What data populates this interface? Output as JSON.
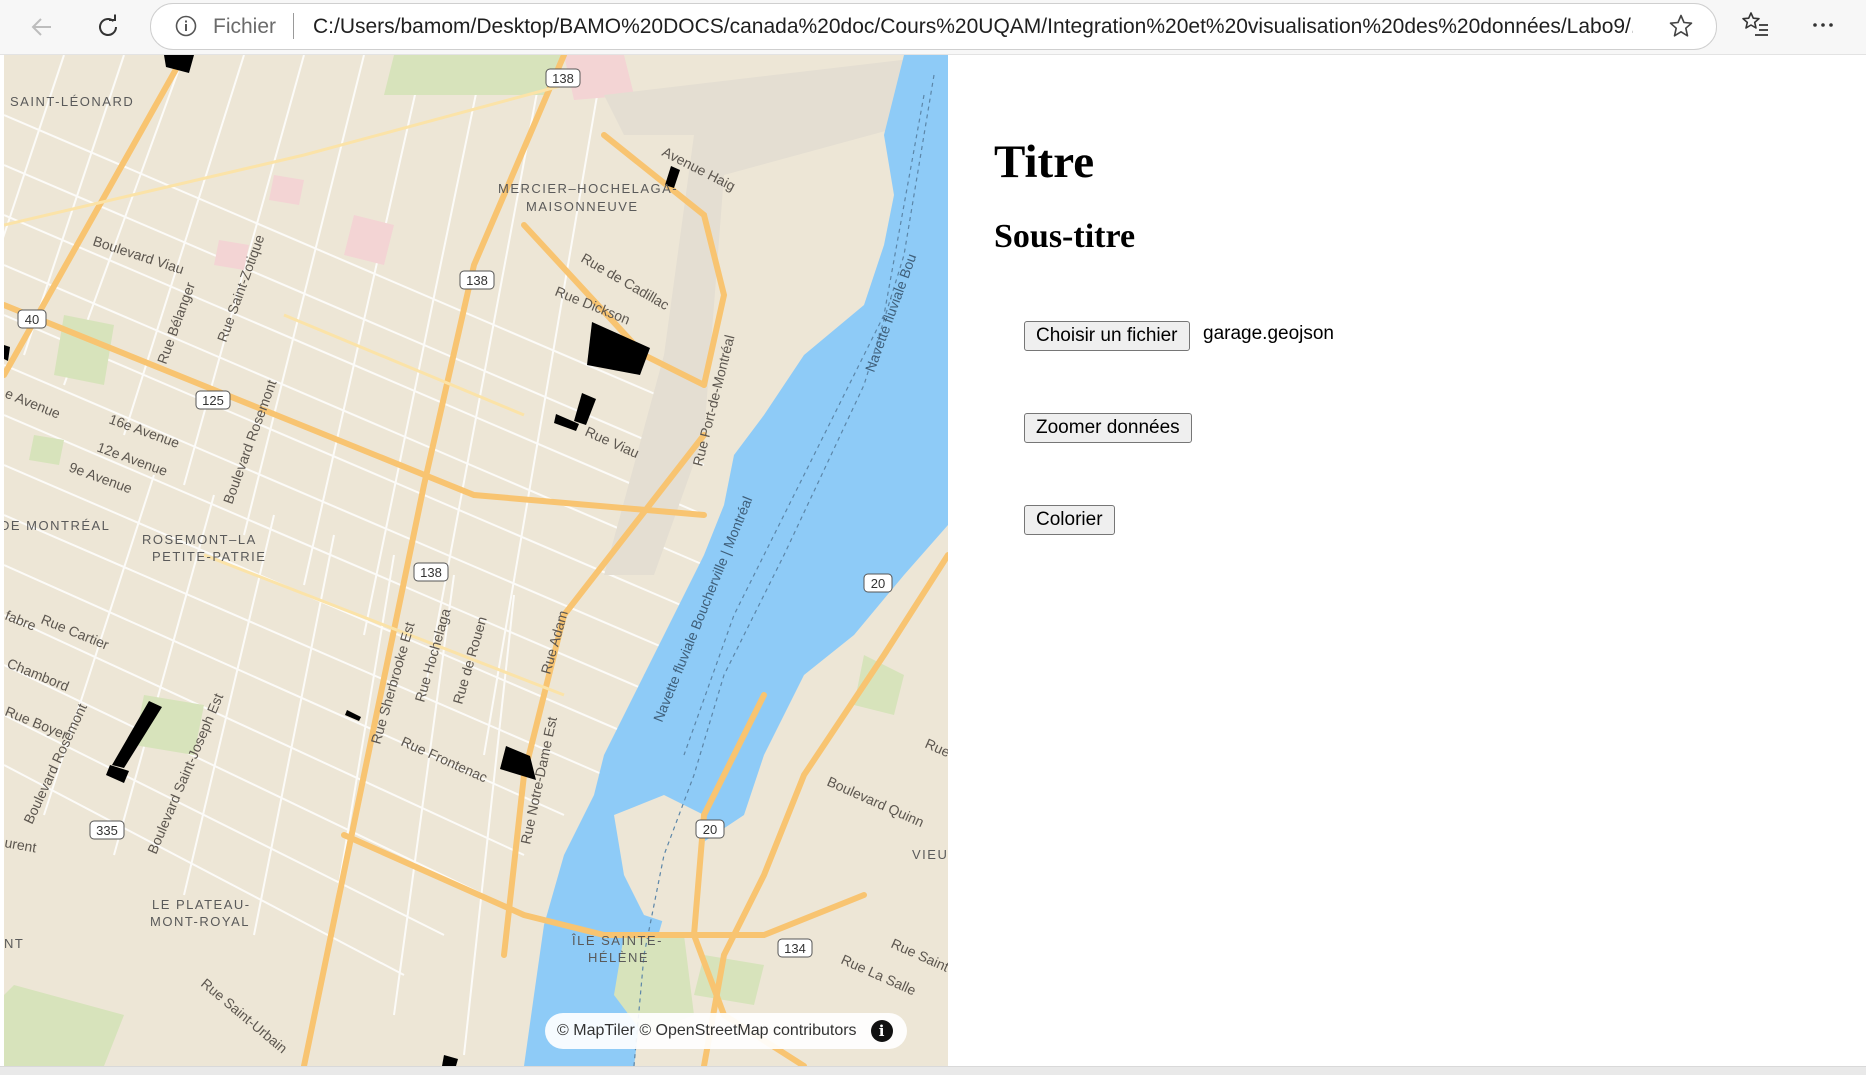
{
  "browser": {
    "scheme_label": "Fichier",
    "url": "C:/Users/bamom/Desktop/BAMO%20DOCS/canada%20doc/Cours%20UQAM/Integration%20et%20visualisation%20des%20données/Labo9/...",
    "icons": [
      "back-arrow-icon",
      "reload-icon",
      "info-icon",
      "star-icon",
      "favorites-icon",
      "more-icon"
    ]
  },
  "map": {
    "districts": [
      "SAINT-LÉONARD",
      "MERCIER–HOCHELAGA-",
      "MAISONNEUVE",
      "ROSEMONT–LA",
      "PETITE-PATRIE",
      "LE PLATEAU-",
      "MONT-ROYAL",
      "ÎLE SAINTE-",
      "HÉLÈNE",
      "DE MONTRÉAL",
      "VIEUX",
      "NT"
    ],
    "streets": [
      "Avenue Haig",
      "Boulevard Viau",
      "Rue de Cadillac",
      "Rue Dickson",
      "Rue Viau",
      "Rue Bélanger",
      "Rue Saint-Zotique",
      "Boulevard Rosemont",
      "16e Avenue",
      "12e Avenue",
      "9e Avenue",
      "Rue Port-de-Montréal",
      "Navette fluviale Bou",
      "Navette fluviale Boucherville | Montréal",
      "Rue Cartier",
      "Chambord",
      "Rue Boyer",
      "Boulevard Rosemont",
      "Boulevard Saint-Joseph Est",
      "Rue Sherbrooke Est",
      "Rue Hochelaga",
      "Rue de Rouen",
      "Rue Adam",
      "Rue Frontenac",
      "Rue Notre-Dame Est",
      "Rue Saint-Urbain",
      "Boulevard Quinn",
      "Rue Saint",
      "Rue La Salle",
      "e Avenue",
      "fabre",
      "urent",
      "Rue"
    ],
    "route_shields": [
      "138",
      "138",
      "138",
      "40",
      "125",
      "20",
      "20",
      "335",
      "134"
    ],
    "attribution": "© MapTiler © OpenStreetMap contributors",
    "attribution_icon": "info-icon",
    "colors": {
      "water": "#8ecbf7",
      "land": "#ede6d6",
      "highway": "#f8c471",
      "parks": "#cfe0b0",
      "features": "#000000"
    }
  },
  "panel": {
    "title": "Titre",
    "subtitle": "Sous-titre",
    "file_button": "Choisir un fichier",
    "file_name": "garage.geojson",
    "zoom_button": "Zoomer données",
    "color_button": "Colorier"
  }
}
